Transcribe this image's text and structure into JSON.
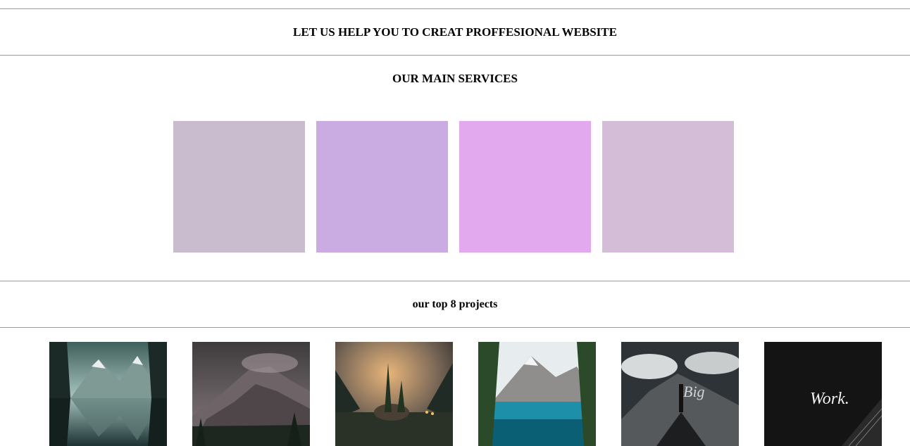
{
  "hero": {
    "title": "LET US HELP YOU TO CREAT PROFFESIONAL WEBSITE"
  },
  "services": {
    "title": "OUR MAIN SERVICES",
    "boxes": [
      {
        "color": "#c9bccf"
      },
      {
        "color": "#caace3"
      },
      {
        "color": "#e3a9ef"
      },
      {
        "color": "#d4bdd6"
      }
    ]
  },
  "projects": {
    "title": "our top 8 projects",
    "items": [
      {
        "image": "mountain-lake-reflection"
      },
      {
        "image": "misty-rocky-mountain"
      },
      {
        "image": "rock-island-trees-at-sunset"
      },
      {
        "image": "alpine-turquoise-lake"
      },
      {
        "image": "hiker-on-mountain-big-text"
      },
      {
        "image": "work-dark-guitar"
      }
    ],
    "overlay_texts": [
      "Big",
      "Work."
    ]
  }
}
